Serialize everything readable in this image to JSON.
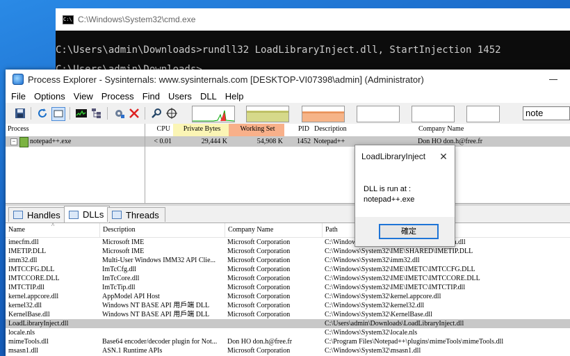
{
  "cmd": {
    "title": "C:\\Windows\\System32\\cmd.exe",
    "line1": "C:\\Users\\admin\\Downloads>rundll32 LoadLibraryInject.dll, StartInjection 1452",
    "line2": "C:\\Users\\admin\\Downloads>"
  },
  "pe": {
    "title": "Process Explorer - Sysinternals: www.sysinternals.com [DESKTOP-VI07398\\admin] (Administrator)",
    "menu": [
      "File",
      "Options",
      "View",
      "Process",
      "Find",
      "Users",
      "DLL",
      "Help"
    ],
    "search_value": "note",
    "proc_columns": [
      "Process",
      "CPU",
      "Private Bytes",
      "Working Set",
      "PID",
      "Description",
      "Company Name"
    ],
    "process": {
      "name": "notepad++.exe",
      "cpu": "< 0.01",
      "private_bytes": "29,444 K",
      "working_set": "54,908 K",
      "pid": "1452",
      "description": "Notepad++",
      "company": "Don HO don.h@free.fr"
    },
    "tabs": [
      "Handles",
      "DLLs",
      "Threads"
    ],
    "dll_columns": [
      "Name",
      "Description",
      "Company Name",
      "Path"
    ],
    "dlls": [
      {
        "name": "imecfm.dll",
        "desc": "Microsoft IME",
        "company": "Microsoft Corporation",
        "path": "C:\\Windows\\System32\\IME\\SHARED\\imecfm.dll"
      },
      {
        "name": "IMETIP.DLL",
        "desc": "Microsoft IME",
        "company": "Microsoft Corporation",
        "path": "C:\\Windows\\System32\\IME\\SHARED\\IMETIP.DLL"
      },
      {
        "name": "imm32.dll",
        "desc": "Multi-User Windows IMM32 API Clie...",
        "company": "Microsoft Corporation",
        "path": "C:\\Windows\\System32\\imm32.dll"
      },
      {
        "name": "IMTCCFG.DLL",
        "desc": "ImTcCfg.dll",
        "company": "Microsoft Corporation",
        "path": "C:\\Windows\\System32\\IME\\IMETC\\IMTCCFG.DLL"
      },
      {
        "name": "IMTCCORE.DLL",
        "desc": "ImTcCore.dll",
        "company": "Microsoft Corporation",
        "path": "C:\\Windows\\System32\\IME\\IMETC\\IMTCCORE.DLL"
      },
      {
        "name": "IMTCTIP.dll",
        "desc": "ImTcTip.dll",
        "company": "Microsoft Corporation",
        "path": "C:\\Windows\\System32\\IME\\IMETC\\IMTCTIP.dll"
      },
      {
        "name": "kernel.appcore.dll",
        "desc": "AppModel API Host",
        "company": "Microsoft Corporation",
        "path": "C:\\Windows\\System32\\kernel.appcore.dll"
      },
      {
        "name": "kernel32.dll",
        "desc": "Windows NT BASE API 用戶端 DLL",
        "company": "Microsoft Corporation",
        "path": "C:\\Windows\\System32\\kernel32.dll"
      },
      {
        "name": "KernelBase.dll",
        "desc": "Windows NT BASE API 用戶端 DLL",
        "company": "Microsoft Corporation",
        "path": "C:\\Windows\\System32\\KernelBase.dll"
      },
      {
        "name": "LoadLibraryInject.dll",
        "desc": "",
        "company": "",
        "path": "C:\\Users\\admin\\Downloads\\LoadLibraryInject.dll",
        "highlight": true
      },
      {
        "name": "locale.nls",
        "desc": "",
        "company": "",
        "path": "C:\\Windows\\System32\\locale.nls"
      },
      {
        "name": "mimeTools.dll",
        "desc": "Base64 encoder/decoder plugin for Not...",
        "company": "Don HO don.h@free.fr",
        "path": "C:\\Program Files\\Notepad++\\plugins\\mimeTools\\mimeTools.dll"
      },
      {
        "name": "msasn1.dll",
        "desc": "ASN.1 Runtime APIs",
        "company": "Microsoft Corporation",
        "path": "C:\\Windows\\System32\\msasn1.dll"
      }
    ]
  },
  "dialog": {
    "title": "LoadLibraryInject",
    "message_line1": "DLL is run at :",
    "message_line2": "notepad++.exe",
    "ok_label": "確定"
  }
}
